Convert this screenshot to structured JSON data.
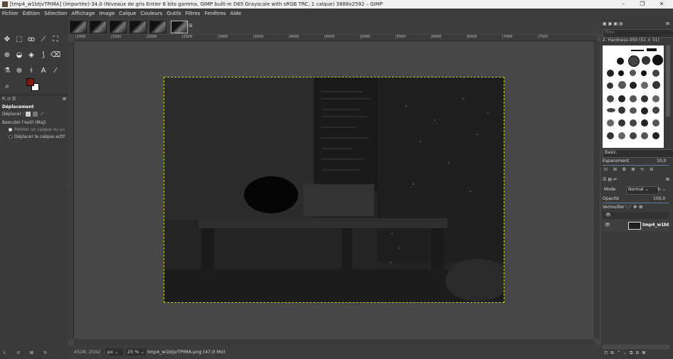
{
  "titlebar": {
    "title": "[tmp4_w1btjvTPIMA] (importée)-34.0 (Niveaux de gris Entier 8 bits gamma, GIMP built-in D65 Grayscale with sRGB TRC, 1 calque) 3888x2592 – GIMP",
    "minimize": "–",
    "maximize": "❐",
    "close": "✕"
  },
  "menu": [
    "Fichier",
    "Édition",
    "Sélection",
    "Affichage",
    "Image",
    "Calque",
    "Couleurs",
    "Outils",
    "Filtres",
    "Fenêtres",
    "Aide"
  ],
  "tools": {
    "row1": [
      "✥",
      "⬚",
      "ꝏ",
      "⟋",
      "⛶"
    ],
    "row2": [
      "⊕",
      "◒",
      "◈",
      "⟆",
      "⌫"
    ],
    "row3": [
      "⚗",
      "⊛",
      "ᚼ",
      "A",
      "⁄"
    ],
    "row4": [
      "⌕"
    ]
  },
  "tool_options": {
    "title": "Déplacement",
    "move_label": "Déplacer :",
    "toggle_label": "Basculer l'outil (Maj)",
    "option1": "Pointer un calque ou un",
    "option2": "Déplacer le calque actif"
  },
  "ruler_labels": [
    "|1000",
    "|1500",
    "|2000",
    "|2500",
    "|3000",
    "|3500",
    "|4000",
    "|4500",
    "|5000",
    "|5500",
    "|6000",
    "|6500",
    "|7000",
    "|7500"
  ],
  "status": {
    "coords": "4528, 2592",
    "unit": "px",
    "zoom": "25 %",
    "file": "tmp4_w1btjvTPIMA.png (47,0 Mo)"
  },
  "brushes": {
    "filter_placeholder": "filtre",
    "current_brush": "2. Hardness 050 (51 × 51)",
    "preset": "Basic,",
    "spacing_label": "Espacement",
    "spacing_value": "10,0"
  },
  "layers": {
    "mode_label": "Mode",
    "mode_value": "Normal",
    "opacity_label": "Opacité",
    "opacity_value": "100,0",
    "lock_label": "Verrouiller :",
    "layer_name": "tmp4_w1bt"
  },
  "colors": {
    "foreground": "#7a1a12",
    "background": "#ffffff",
    "selection_border": "#c8c820"
  }
}
